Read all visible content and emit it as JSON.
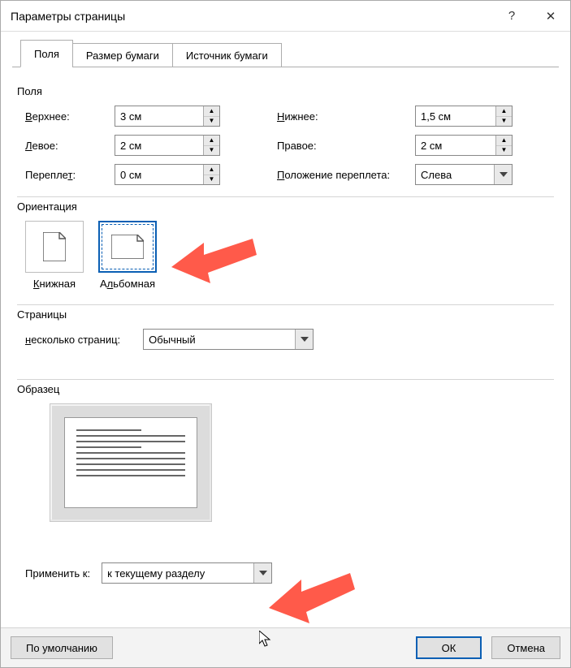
{
  "title": "Параметры страницы",
  "tabs": {
    "margins": "Поля",
    "paper": "Размер бумаги",
    "source": "Источник бумаги"
  },
  "marginsSection": {
    "label": "Поля",
    "top": {
      "label": "Верхнее:",
      "underline": "В",
      "rest": "ерхнее:",
      "value": "3 см"
    },
    "bottom": {
      "label": "Нижнее:",
      "underline": "Н",
      "rest": "ижнее:",
      "value": "1,5 см"
    },
    "left": {
      "label": "Левое:",
      "underline": "Л",
      "rest": "евое:",
      "value": "2 см"
    },
    "right": {
      "label": "Правое:",
      "underline": "",
      "rest": "Правое:",
      "value": "2 см"
    },
    "gutter": {
      "label": "Переплет:",
      "underline": "",
      "rest": "Перепле",
      "tail": "т",
      "value": "0 см"
    },
    "gutterPos": {
      "label": "Положение переплета:",
      "underline": "П",
      "rest": "оложение переплета:",
      "value": "Слева"
    }
  },
  "orientation": {
    "label": "Ориентация",
    "portrait": "Книжная",
    "landscape": "Альбомная"
  },
  "pages": {
    "label": "Страницы",
    "multiLabel": "несколько страниц:",
    "underline": "н",
    "rest": "есколько страниц:",
    "value": "Обычный"
  },
  "preview": {
    "label": "Образец"
  },
  "apply": {
    "label": "Применить к:",
    "underline": "",
    "rest": "Применить к:",
    "value": "к текущему разделу"
  },
  "buttons": {
    "default": "По умолчанию",
    "ok": "ОК",
    "cancel": "Отмена"
  },
  "titleButtons": {
    "help": "?",
    "close": "✕"
  }
}
